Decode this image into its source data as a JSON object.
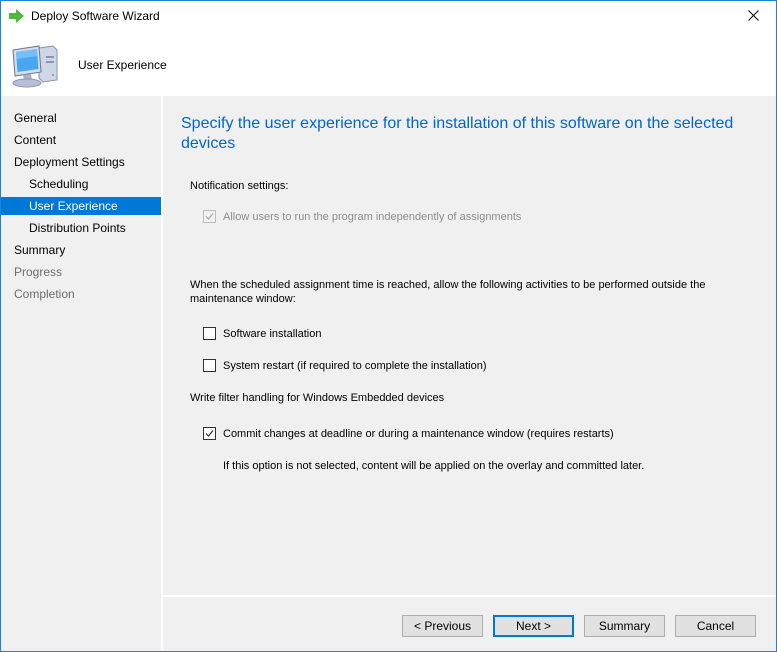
{
  "window": {
    "title": "Deploy Software Wizard",
    "title_icon": "green-arrow-icon",
    "close_icon": "close-icon"
  },
  "header": {
    "title": "User Experience",
    "icon": "computer-icon"
  },
  "sidebar": {
    "items": [
      {
        "label": "General",
        "level": 0,
        "state": "normal"
      },
      {
        "label": "Content",
        "level": 0,
        "state": "normal"
      },
      {
        "label": "Deployment Settings",
        "level": 0,
        "state": "normal"
      },
      {
        "label": "Scheduling",
        "level": 1,
        "state": "normal"
      },
      {
        "label": "User Experience",
        "level": 1,
        "state": "selected"
      },
      {
        "label": "Distribution Points",
        "level": 1,
        "state": "normal"
      },
      {
        "label": "Summary",
        "level": 0,
        "state": "normal"
      },
      {
        "label": "Progress",
        "level": 0,
        "state": "disabled"
      },
      {
        "label": "Completion",
        "level": 0,
        "state": "disabled"
      }
    ]
  },
  "main": {
    "heading": "Specify the user experience for the installation of this software on the selected devices",
    "notification_label": "Notification settings:",
    "allow_users": {
      "label": "Allow users to run the program independently of assignments",
      "checked": true,
      "enabled": false
    },
    "maintenance_label": "When the scheduled assignment time is reached, allow the following activities to be performed outside the maintenance window:",
    "software_installation": {
      "label": "Software installation",
      "checked": false,
      "enabled": true
    },
    "system_restart": {
      "label": "System restart (if required to complete the installation)",
      "checked": false,
      "enabled": true
    },
    "write_filter_label": "Write filter handling for Windows Embedded devices",
    "commit_changes": {
      "label": "Commit changes at deadline or during a maintenance window (requires restarts)",
      "checked": true,
      "enabled": true
    },
    "commit_note": "If this option is not selected, content will be applied on the overlay and committed later."
  },
  "buttons": {
    "previous": "< Previous",
    "next": "Next >",
    "summary": "Summary",
    "cancel": "Cancel"
  },
  "colors": {
    "accent": "#0078d7",
    "heading": "#0066cc",
    "window_border": "#1883d7"
  }
}
